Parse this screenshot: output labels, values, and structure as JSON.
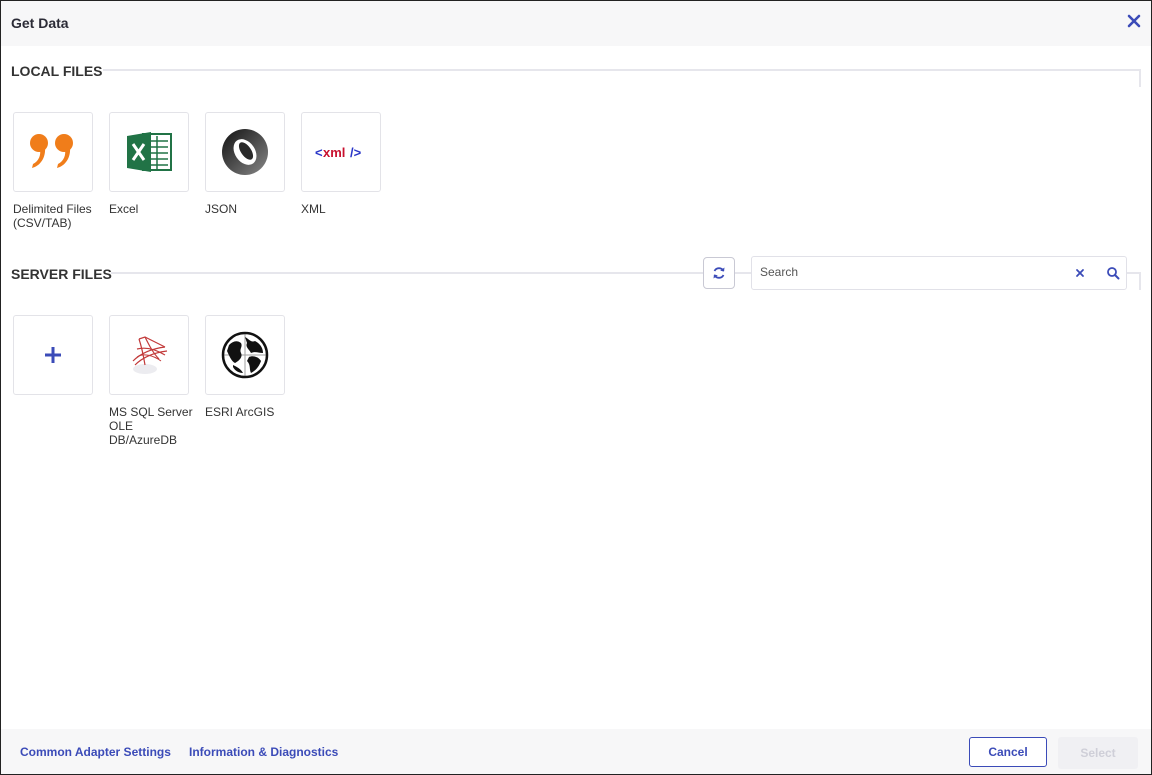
{
  "dialog": {
    "title": "Get Data"
  },
  "local_files": {
    "title": "LOCAL FILES",
    "items": [
      {
        "label": "Delimited Files (CSV/TAB)",
        "icon": "quote-icon"
      },
      {
        "label": "Excel",
        "icon": "excel-icon"
      },
      {
        "label": "JSON",
        "icon": "json-icon"
      },
      {
        "label": "XML",
        "icon": "xml-icon",
        "icon_text": "<xml />"
      }
    ]
  },
  "server_files": {
    "title": "SERVER FILES",
    "search": {
      "placeholder": "Search",
      "value": ""
    },
    "items": [
      {
        "label": "",
        "icon": "plus-icon"
      },
      {
        "label": "MS SQL Server OLE DB/AzureDB",
        "icon": "sql-server-icon"
      },
      {
        "label": "ESRI ArcGIS",
        "icon": "globe-icon"
      }
    ]
  },
  "footer": {
    "links": [
      "Common Adapter Settings",
      "Information & Diagnostics"
    ],
    "cancel_label": "Cancel",
    "select_label": "Select"
  },
  "colors": {
    "accent": "#3b4bb8",
    "quote_orange": "#f07d1a",
    "excel_green": "#217346",
    "xml_red": "#c8102e",
    "xml_blue": "#2a36c8"
  }
}
